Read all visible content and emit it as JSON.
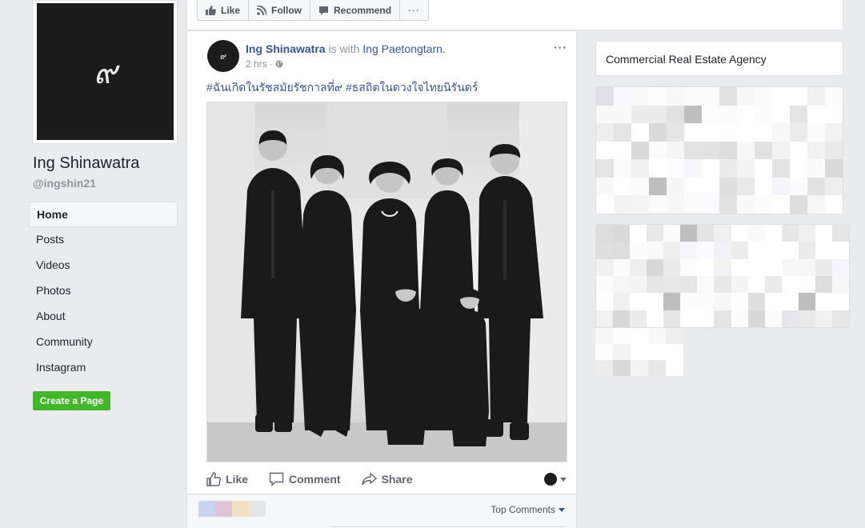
{
  "page": {
    "name": "Ing Shinawatra",
    "handle": "@ingshin21",
    "avatar_glyph": "๙",
    "nav": [
      {
        "label": "Home",
        "active": true
      },
      {
        "label": "Posts",
        "active": false
      },
      {
        "label": "Videos",
        "active": false
      },
      {
        "label": "Photos",
        "active": false
      },
      {
        "label": "About",
        "active": false
      },
      {
        "label": "Community",
        "active": false
      },
      {
        "label": "Instagram",
        "active": false
      }
    ],
    "create_page_label": "Create a Page"
  },
  "top_actions": {
    "like": "Like",
    "follow": "Follow",
    "recommend": "Recommend",
    "more": "···"
  },
  "post": {
    "author": "Ing Shinawatra",
    "with_text": "is with",
    "tagged": "Ing Paetongtarn.",
    "time": "2 hrs",
    "menu": "···",
    "text": "#ฉันเกิดในรัชสมัยรัชกาลที่๙ #ธสถิตในดวงใจไทยนิรันดร์",
    "actions": {
      "like": "Like",
      "comment": "Comment",
      "share": "Share"
    },
    "top_comments": "Top Comments"
  },
  "sidebar_right": {
    "card_title": "Commercial Real Estate Agency"
  },
  "colors": {
    "link": "#365899",
    "create_button": "#42b72a",
    "background": "#e9ebee"
  }
}
